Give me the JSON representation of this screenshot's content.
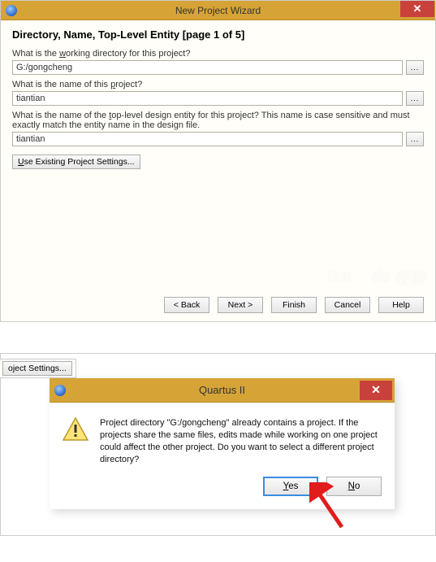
{
  "wizard": {
    "window_title": "New Project Wizard",
    "heading": "Directory, Name, Top-Level Entity [page 1 of 5]",
    "q1_pre": "What is the ",
    "q1_u": "w",
    "q1_post": "orking directory for this project?",
    "dir_value": "G:/gongcheng",
    "q2_pre": "What is the name of this ",
    "q2_u": "p",
    "q2_post": "roject?",
    "name_value": "tiantian",
    "q3_pre": "What is the name of the ",
    "q3_u": "t",
    "q3_post": "op-level design entity for this project? This name is case sensitive and must exactly match the entity name in the design file.",
    "entity_value": "tiantian",
    "use_existing_u": "U",
    "use_existing_rest": "se Existing Project Settings...",
    "browse": "...",
    "buttons": {
      "back": "< Back",
      "next": "Next >",
      "finish": "Finish",
      "cancel": "Cancel",
      "help": "Help"
    },
    "watermark_1": "Bai",
    "watermark_2": "du",
    "watermark_3": "经验"
  },
  "dialog": {
    "window_title": "Quartus II",
    "message": "Project directory \"G:/gongcheng\" already contains a project. If the projects share the same files, edits made while working on one project could affect the other project. Do you want to select a different project directory?",
    "yes_u": "Y",
    "yes_rest": "es",
    "no_u": "N",
    "no_rest": "o",
    "fragment_btn": "oject Settings..."
  }
}
